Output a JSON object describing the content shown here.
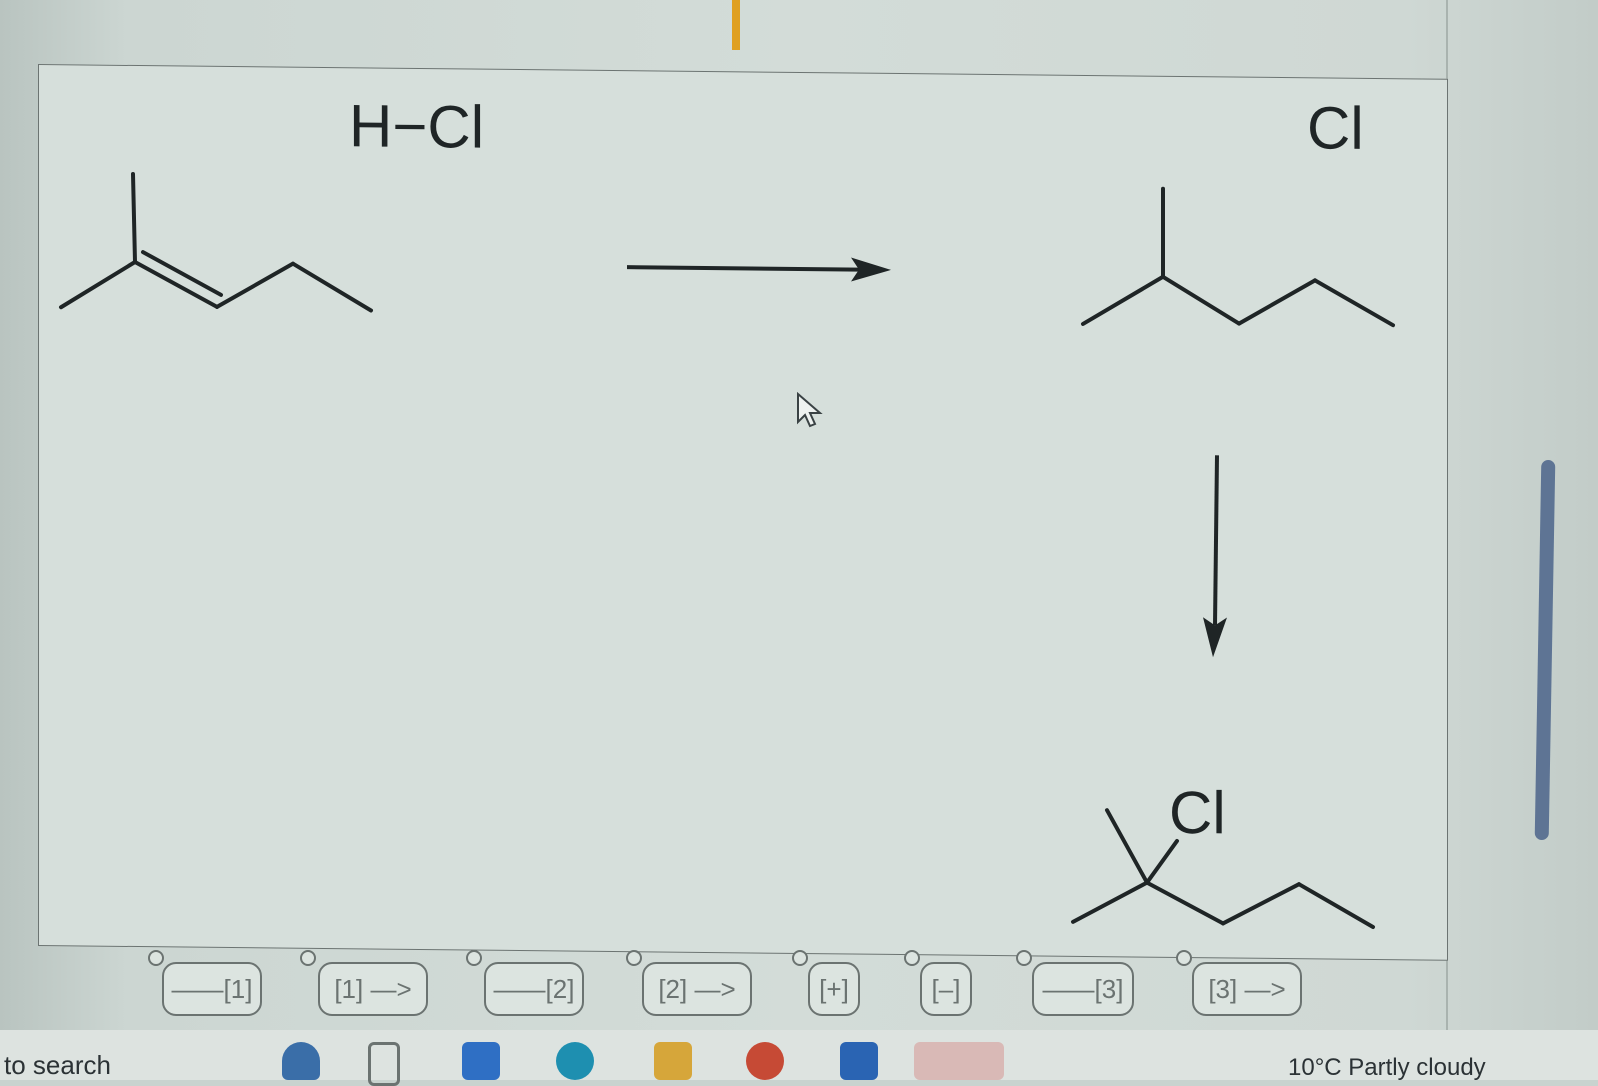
{
  "reaction": {
    "reagent_label": "H−Cl",
    "product_top_label": "Cl",
    "product_bottom_label": "Cl"
  },
  "toolbar": {
    "buttons": [
      "——[1]",
      "[1] —>",
      "——[2]",
      "[2] —>",
      "[+]",
      "[–]",
      "——[3]",
      "[3] —>"
    ]
  },
  "taskbar": {
    "search_text": "to search",
    "weather_text": "10°C  Partly cloudy"
  },
  "colors": {
    "bond_stroke": "#1f2526",
    "button_border": "#6b7371",
    "scrollbar": "#5e7494",
    "accent_orange": "#e0a020"
  }
}
